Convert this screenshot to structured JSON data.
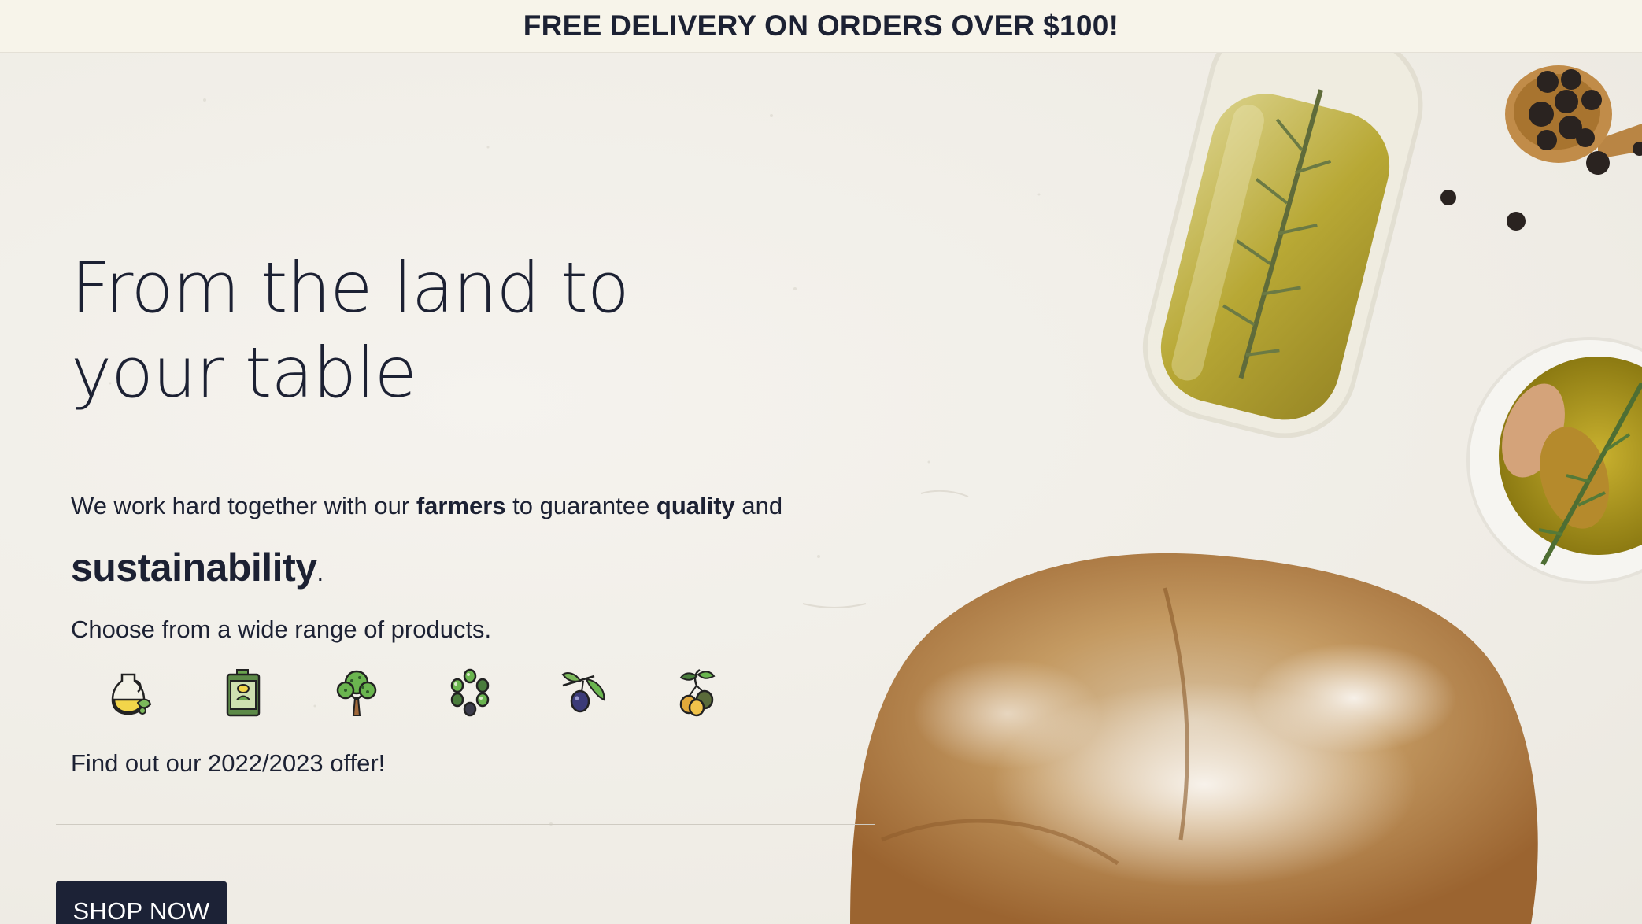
{
  "promo": {
    "text": "FREE DELIVERY ON ORDERS OVER $100!"
  },
  "hero": {
    "headline": "From the land to your table",
    "lead": {
      "part1": "We work hard together with our ",
      "farmers": "farmers",
      "part2": " to guarantee ",
      "quality": "quality",
      "part3": " and",
      "sustainability": "sustainability",
      "period": "."
    },
    "range_text": "Choose from a wide range of products.",
    "categories": [
      {
        "icon": "oil-jug-icon"
      },
      {
        "icon": "oil-tin-icon"
      },
      {
        "icon": "olive-tree-icon"
      },
      {
        "icon": "olives-cluster-icon"
      },
      {
        "icon": "olive-branch-icon"
      },
      {
        "icon": "olives-pair-icon"
      }
    ],
    "offer_text": "Find out our 2022/2023 offer!",
    "cta_label": "SHOP NOW"
  },
  "colors": {
    "navy": "#1c2236",
    "promo_bg": "#f7f4ea",
    "hero_bg": "#f2efe8",
    "olive_oil": "#b9a32a",
    "bread": "#c08a4c"
  }
}
